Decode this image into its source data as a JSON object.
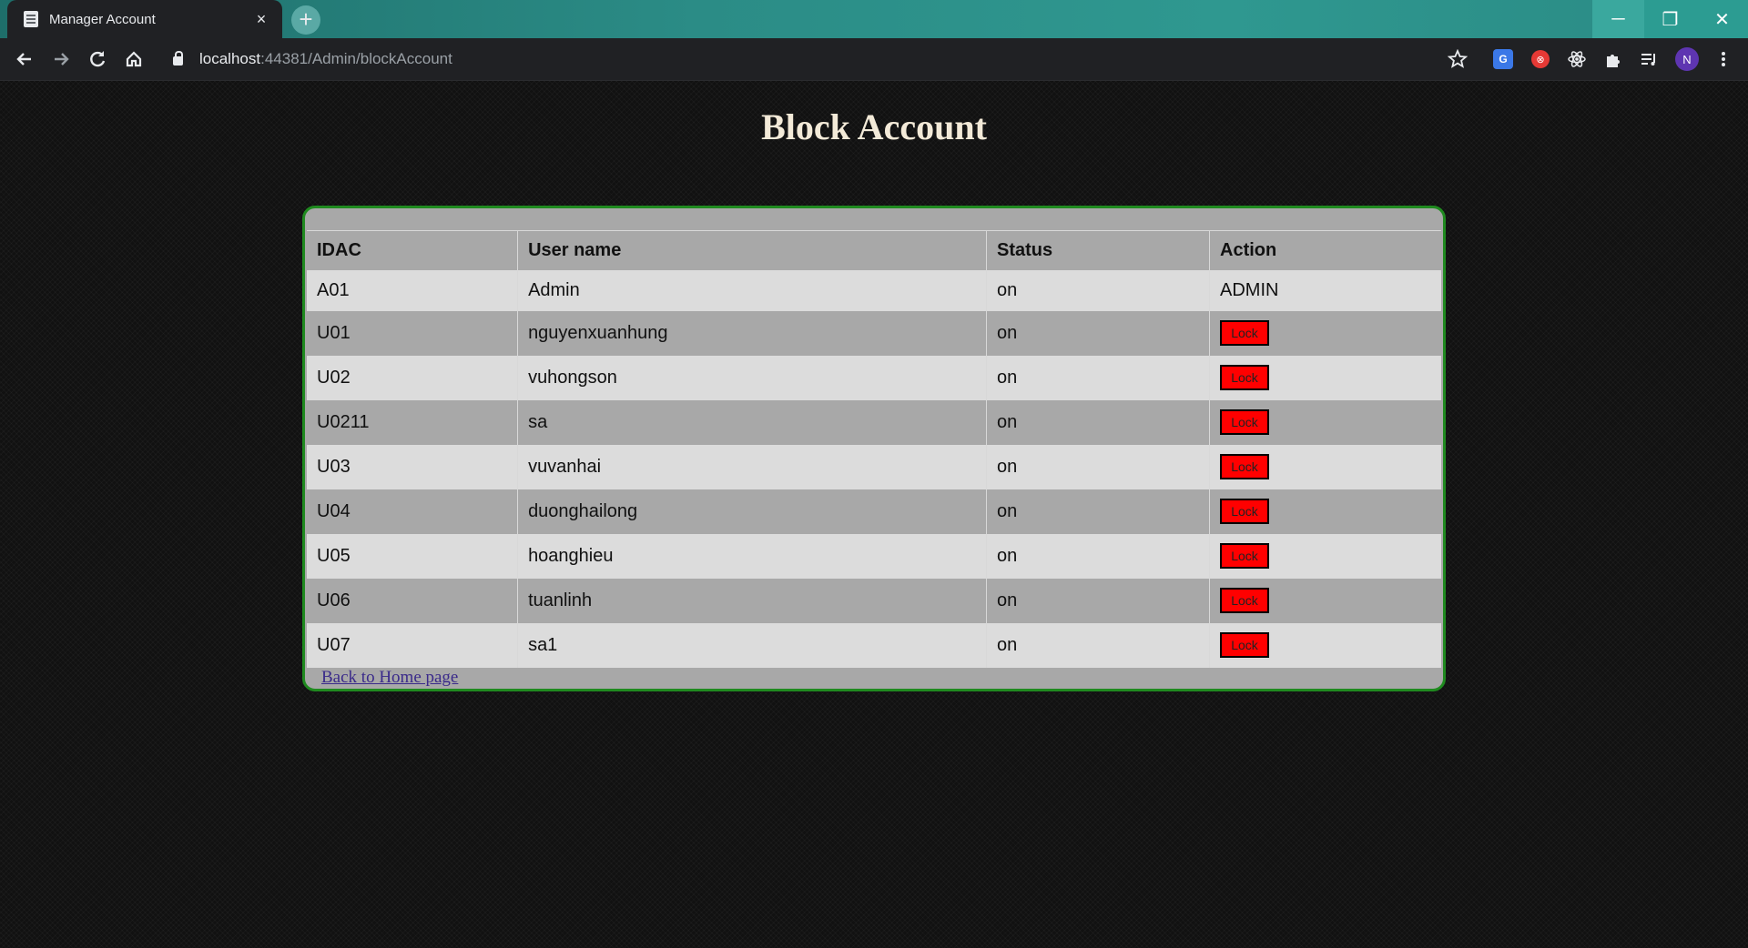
{
  "browser": {
    "tab_title": "Manager Account",
    "tab_close": "×",
    "new_tab": "+",
    "url_host": "localhost",
    "url_rest": ":44381/Admin/blockAccount",
    "profile_initial": "N",
    "window_min": "─",
    "window_max": "❐",
    "window_close": "✕"
  },
  "page": {
    "title": "Block Account",
    "table": {
      "headers": [
        "IDAC",
        "User name",
        "Status",
        "Action"
      ],
      "rows": [
        {
          "id": "A01",
          "username": "Admin",
          "status": "on",
          "action": "ADMIN"
        },
        {
          "id": "U01",
          "username": "nguyenxuanhung",
          "status": "on",
          "action": "Lock"
        },
        {
          "id": "U02",
          "username": "vuhongson",
          "status": "on",
          "action": "Lock"
        },
        {
          "id": "U0211",
          "username": "sa",
          "status": "on",
          "action": "Lock"
        },
        {
          "id": "U03",
          "username": "vuvanhai",
          "status": "on",
          "action": "Lock"
        },
        {
          "id": "U04",
          "username": "duonghailong",
          "status": "on",
          "action": "Lock"
        },
        {
          "id": "U05",
          "username": "hoanghieu",
          "status": "on",
          "action": "Lock"
        },
        {
          "id": "U06",
          "username": "tuanlinh",
          "status": "on",
          "action": "Lock"
        },
        {
          "id": "U07",
          "username": "sa1",
          "status": "on",
          "action": "Lock"
        }
      ]
    },
    "back_link": "Back to Home page"
  },
  "colors": {
    "panel_border": "#1f8a1f",
    "lock_button": "#ff0000",
    "title_text": "#f3ead8"
  },
  "icons": [
    "back-arrow-icon",
    "forward-arrow-icon",
    "reload-icon",
    "home-icon",
    "lock-icon",
    "star-icon",
    "translate-icon",
    "extension-icon",
    "puzzle-icon",
    "reading-list-icon",
    "menu-icon"
  ]
}
